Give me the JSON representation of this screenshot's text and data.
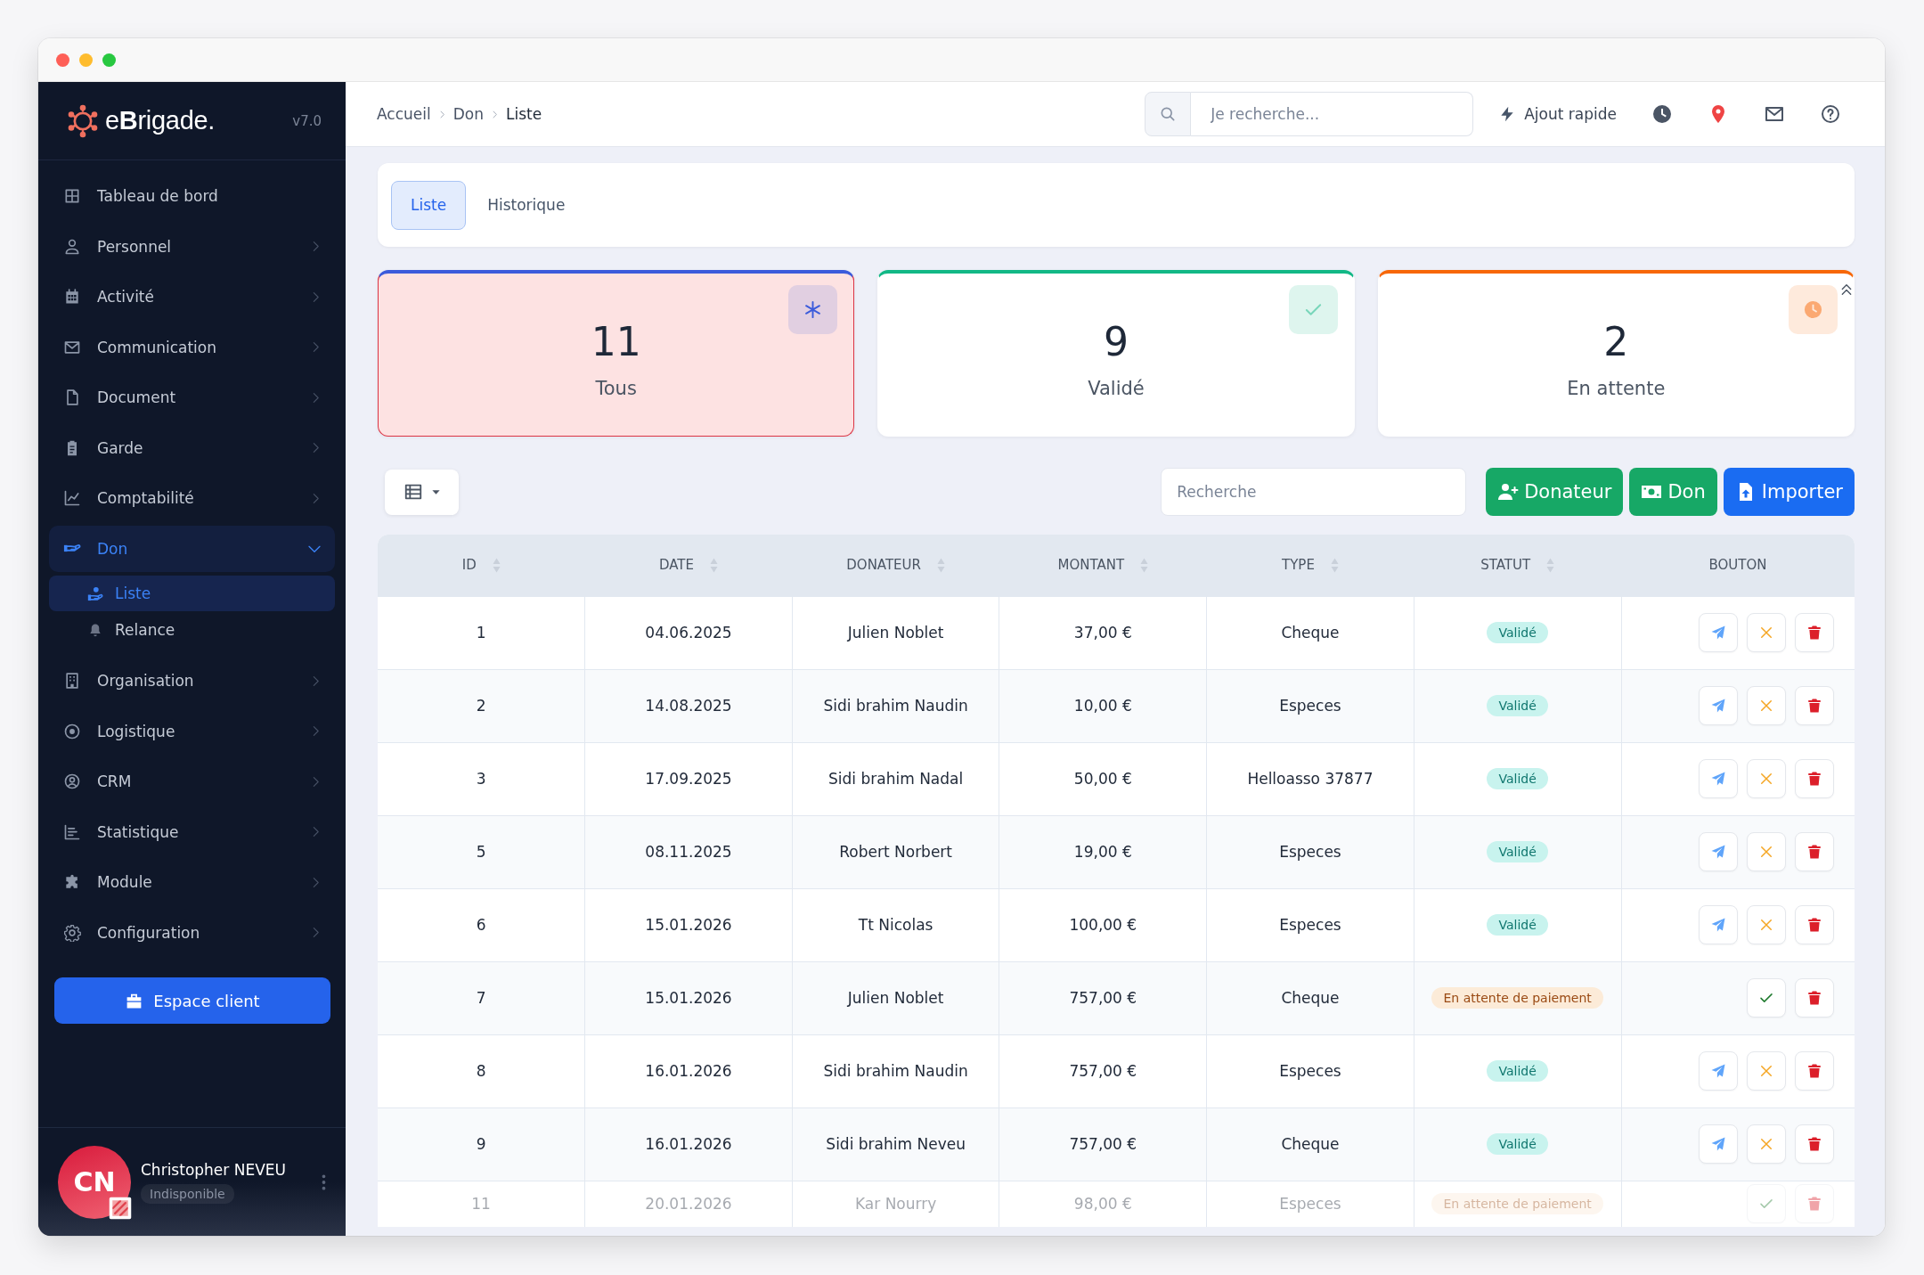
{
  "sidebar": {
    "logo": "e**B**rigade.",
    "version": "v7.0",
    "items": [
      {
        "label": "Tableau de bord",
        "has_submenu": false,
        "expanded": false,
        "selected": false
      },
      {
        "label": "Personnel",
        "has_submenu": true,
        "expanded": false,
        "selected": false
      },
      {
        "label": "Activité",
        "has_submenu": true,
        "expanded": false,
        "selected": false
      },
      {
        "label": "Communication",
        "has_submenu": true,
        "expanded": false,
        "selected": false
      },
      {
        "label": "Document",
        "has_submenu": true,
        "expanded": false,
        "selected": false
      },
      {
        "label": "Garde",
        "has_submenu": true,
        "expanded": false,
        "selected": false
      },
      {
        "label": "Comptabilité",
        "has_submenu": true,
        "expanded": false,
        "selected": false
      },
      {
        "label": "Don",
        "has_submenu": true,
        "expanded": true,
        "selected": true,
        "children": [
          {
            "label": "Liste",
            "selected": true
          },
          {
            "label": "Relance",
            "selected": false
          }
        ]
      },
      {
        "label": "Organisation",
        "has_submenu": true,
        "expanded": false,
        "selected": false
      },
      {
        "label": "Logistique",
        "has_submenu": true,
        "expanded": false,
        "selected": false
      },
      {
        "label": "CRM",
        "has_submenu": true,
        "expanded": false,
        "selected": false
      },
      {
        "label": "Statistique",
        "has_submenu": true,
        "expanded": false,
        "selected": false
      },
      {
        "label": "Module",
        "has_submenu": true,
        "expanded": false,
        "selected": false
      },
      {
        "label": "Configuration",
        "has_submenu": true,
        "expanded": false,
        "selected": false
      }
    ],
    "client_button": "Espace client",
    "user": {
      "initials": "CN",
      "name": "Christopher NEVEU",
      "status": "Indisponible"
    }
  },
  "topbar": {
    "breadcrumb": [
      "Accueil",
      "Don",
      "Liste"
    ],
    "search": {
      "placeholder": "Je recherche..."
    },
    "quick_add": "Ajout rapide"
  },
  "tabs": [
    {
      "label": "Liste",
      "selected": true
    },
    {
      "label": "Historique",
      "selected": false
    }
  ],
  "stats": [
    {
      "value": "11",
      "label": "Tous",
      "color": "#3b5bdb",
      "selected": true
    },
    {
      "value": "9",
      "label": "Validé",
      "color": "#12b886",
      "selected": false
    },
    {
      "value": "2",
      "label": "En attente",
      "color": "#f76707",
      "selected": false
    }
  ],
  "toolbar": {
    "search": {
      "placeholder": "Recherche"
    },
    "buttons": [
      {
        "label": "Donateur",
        "kind": "add-donor"
      },
      {
        "label": "Don",
        "kind": "add-donation"
      },
      {
        "label": "Importer",
        "kind": "import"
      }
    ]
  },
  "table": {
    "columns": [
      {
        "label": "ID",
        "sortable": true
      },
      {
        "label": "DATE",
        "sortable": true
      },
      {
        "label": "DONATEUR",
        "sortable": true
      },
      {
        "label": "MONTANT",
        "sortable": true
      },
      {
        "label": "TYPE",
        "sortable": true
      },
      {
        "label": "STATUT",
        "sortable": true
      },
      {
        "label": "BOUTON",
        "sortable": false
      }
    ],
    "rows": [
      {
        "id": "1",
        "date": "04.06.2025",
        "donor": "Julien Noblet",
        "amount": "37,00 €",
        "type": "Cheque",
        "status": {
          "label": "Validé",
          "kind": "validated"
        },
        "actions": [
          {
            "kind": "send"
          },
          {
            "kind": "cancel"
          },
          {
            "kind": "delete"
          }
        ]
      },
      {
        "id": "2",
        "date": "14.08.2025",
        "donor": "Sidi brahim Naudin",
        "amount": "10,00 €",
        "type": "Especes",
        "status": {
          "label": "Validé",
          "kind": "validated"
        },
        "actions": [
          {
            "kind": "send"
          },
          {
            "kind": "cancel"
          },
          {
            "kind": "delete"
          }
        ]
      },
      {
        "id": "3",
        "date": "17.09.2025",
        "donor": "Sidi brahim Nadal",
        "amount": "50,00 €",
        "type": "Helloasso 37877",
        "status": {
          "label": "Validé",
          "kind": "validated"
        },
        "actions": [
          {
            "kind": "send"
          },
          {
            "kind": "cancel"
          },
          {
            "kind": "delete"
          }
        ]
      },
      {
        "id": "5",
        "date": "08.11.2025",
        "donor": "Robert Norbert",
        "amount": "19,00 €",
        "type": "Especes",
        "status": {
          "label": "Validé",
          "kind": "validated"
        },
        "actions": [
          {
            "kind": "send"
          },
          {
            "kind": "cancel"
          },
          {
            "kind": "delete"
          }
        ]
      },
      {
        "id": "6",
        "date": "15.01.2026",
        "donor": "Tt Nicolas",
        "amount": "100,00 €",
        "type": "Especes",
        "status": {
          "label": "Validé",
          "kind": "validated"
        },
        "actions": [
          {
            "kind": "send"
          },
          {
            "kind": "cancel"
          },
          {
            "kind": "delete"
          }
        ]
      },
      {
        "id": "7",
        "date": "15.01.2026",
        "donor": "Julien Noblet",
        "amount": "757,00 €",
        "type": "Cheque",
        "status": {
          "label": "En attente de paiement",
          "kind": "pending"
        },
        "actions": [
          {
            "kind": "validate"
          },
          {
            "kind": "delete"
          }
        ]
      },
      {
        "id": "8",
        "date": "16.01.2026",
        "donor": "Sidi brahim Naudin",
        "amount": "757,00 €",
        "type": "Especes",
        "status": {
          "label": "Validé",
          "kind": "validated"
        },
        "actions": [
          {
            "kind": "send"
          },
          {
            "kind": "cancel"
          },
          {
            "kind": "delete"
          }
        ]
      },
      {
        "id": "9",
        "date": "16.01.2026",
        "donor": "Sidi brahim Neveu",
        "amount": "757,00 €",
        "type": "Cheque",
        "status": {
          "label": "Validé",
          "kind": "validated"
        },
        "actions": [
          {
            "kind": "send"
          },
          {
            "kind": "cancel"
          },
          {
            "kind": "delete"
          }
        ]
      },
      {
        "id": "11",
        "date": "20.01.2026",
        "donor": "Kar Nourry",
        "amount": "98,00 €",
        "type": "Especes",
        "status": {
          "label": "En attente de paiement",
          "kind": "pending"
        },
        "actions": [
          {
            "kind": "validate"
          },
          {
            "kind": "delete"
          }
        ]
      }
    ]
  }
}
